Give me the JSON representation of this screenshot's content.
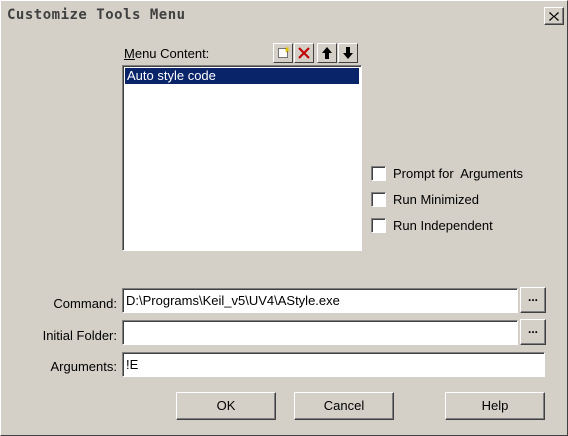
{
  "window": {
    "title": "Customize Tools Menu",
    "close_icon": "close-icon"
  },
  "menu_content": {
    "label_underline": "M",
    "label_rest": "enu Content:",
    "toolbar": [
      {
        "name": "new-item-icon",
        "tooltip": ""
      },
      {
        "name": "delete-item-icon",
        "tooltip": ""
      },
      {
        "name": "move-up-icon",
        "tooltip": ""
      },
      {
        "name": "move-down-icon",
        "tooltip": ""
      }
    ],
    "items": [
      {
        "label": "Auto style code",
        "selected": true
      }
    ]
  },
  "options": [
    {
      "label": "Prompt for  Arguments",
      "checked": false
    },
    {
      "label": "Run Minimized",
      "checked": false
    },
    {
      "label": "Run Independent",
      "checked": false
    }
  ],
  "fields": {
    "command": {
      "label": "Command:",
      "value": "D:\\Programs\\Keil_v5\\UV4\\AStyle.exe",
      "browse_label": "..."
    },
    "initial_folder": {
      "label": "Initial Folder:",
      "value": "",
      "browse_label": "..."
    },
    "arguments": {
      "label": "Arguments:",
      "value": "!E"
    }
  },
  "buttons": {
    "ok": "OK",
    "cancel": "Cancel",
    "help": "Help"
  },
  "colors": {
    "face": "#d4d0c8",
    "selection": "#0a246a",
    "delete_red": "#c00000"
  }
}
